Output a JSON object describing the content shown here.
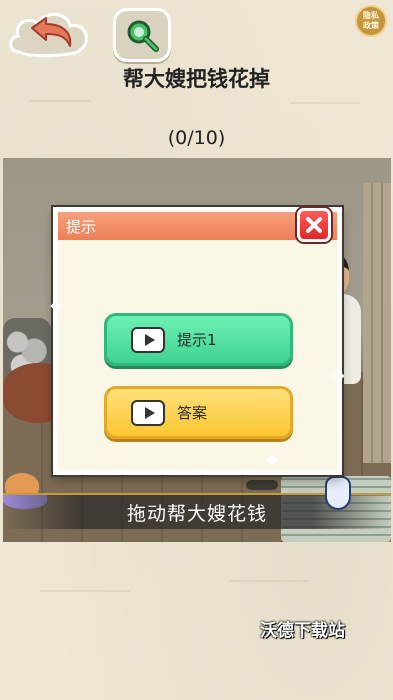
{
  "header": {
    "back_button": {
      "icon": "back-arrow-icon"
    },
    "search_button": {
      "icon": "magnifier-icon"
    },
    "privacy_badge": {
      "line1": "隐私",
      "line2": "政策"
    }
  },
  "level": {
    "title": "帮大嫂把钱花掉",
    "progress": "(0/10)"
  },
  "scene": {
    "instruction": "拖动帮大嫂花钱"
  },
  "dialog": {
    "title": "提示",
    "close_icon": "close-x-icon",
    "buttons": [
      {
        "label": "提示1",
        "icon": "video-icon",
        "color": "#3fd392"
      },
      {
        "label": "答案",
        "icon": "video-icon",
        "color": "#fbc631"
      }
    ]
  },
  "watermark": "沃德下载站",
  "colors": {
    "dialog_header": "#ee7f58",
    "close_button": "#e22626",
    "hint_button": "#3fd392",
    "answer_button": "#fbc631"
  }
}
